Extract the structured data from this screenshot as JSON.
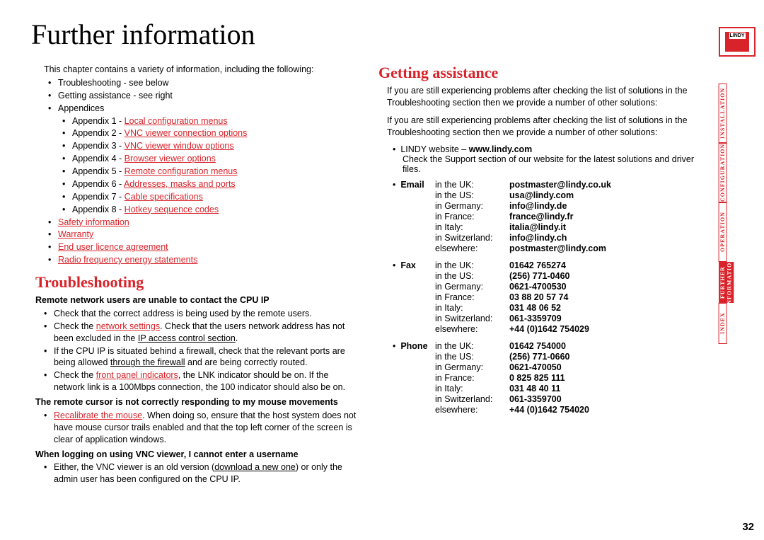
{
  "page_title": "Further information",
  "page_number": "32",
  "logo_text": "LINDY",
  "sidebar": {
    "tabs": [
      {
        "label": "INSTALLATION",
        "active": false
      },
      {
        "label": "CONFIGURATION",
        "active": false
      },
      {
        "label": "OPERATION",
        "active": false
      },
      {
        "label": "FURTHER\nINFORMATION",
        "active": true
      },
      {
        "label": "INDEX",
        "active": false
      }
    ]
  },
  "left": {
    "intro": "This chapter contains a variety of information, including the following:",
    "top_items": [
      {
        "text": "Troubleshooting - see below"
      },
      {
        "text": "Getting assistance - see right"
      },
      {
        "text": "Appendices"
      }
    ],
    "appendices": [
      {
        "prefix": "Appendix 1 - ",
        "link": "Local configuration menus"
      },
      {
        "prefix": "Appendix 2 - ",
        "link": "VNC viewer connection options"
      },
      {
        "prefix": "Appendix 3 - ",
        "link": "VNC viewer window options"
      },
      {
        "prefix": "Appendix 4 - ",
        "link": "Browser viewer options"
      },
      {
        "prefix": "Appendix 5 - ",
        "link": "Remote configuration menus"
      },
      {
        "prefix": "Appendix 6 - ",
        "link": "Addresses, masks and ports"
      },
      {
        "prefix": "Appendix 7 - ",
        "link": "Cable specifications"
      },
      {
        "prefix": "Appendix 8 - ",
        "link": "Hotkey sequence codes"
      }
    ],
    "extra_links": [
      "Safety information",
      "Warranty",
      "End user licence agreement",
      "Radio frequency energy statements"
    ],
    "troubleshooting_heading": "Troubleshooting",
    "ts1": {
      "head": "Remote network users are unable to contact the CPU IP",
      "b1": "Check that the correct address is being used by the remote users.",
      "b2_pre": "Check the ",
      "b2_link": "network settings",
      "b2_mid": ". Check that the users network address has not been excluded in the ",
      "b2_link2": "IP access control section",
      "b2_post": ".",
      "b3_pre": "If the CPU IP is situated behind a firewall, check that the relevant ports are being allowed ",
      "b3_link": "through the firewall",
      "b3_post": " and are being correctly routed.",
      "b4_pre": "Check the ",
      "b4_link": "front panel indicators",
      "b4_post": ", the LNK indicator should be on. If the network link is a 100Mbps connection, the 100 indicator should also be on."
    },
    "ts2": {
      "head": "The remote cursor is not correctly responding to my mouse movements",
      "b1_link": "Recalibrate the mouse",
      "b1_post": ". When doing so, ensure that the host system does not have mouse cursor trails enabled and that the top left corner of the screen is clear of application windows."
    },
    "ts3": {
      "head": "When logging on using VNC viewer, I cannot enter a username",
      "b1_pre": "Either, the VNC viewer is an old version (",
      "b1_link": "download a new one",
      "b1_post": ") or only the admin user has been configured on the CPU IP."
    }
  },
  "right": {
    "heading": "Getting assistance",
    "p1": "If you are still experiencing problems after checking the list of solutions in the Troubleshooting section then we provide a number of other solutions:",
    "p2": "If you are still experiencing problems after checking the list of solutions in the Troubleshooting section then we provide a number of other solutions:",
    "website_label_pre": "LINDY website – ",
    "website_label_bold": "www.lindy.com",
    "website_desc": "Check the Support section of our website for the latest solutions and driver files.",
    "contacts": [
      {
        "type": "Email",
        "rows": [
          {
            "loc": "in the UK:",
            "val": "postmaster@lindy.co.uk"
          },
          {
            "loc": "in the US:",
            "val": "usa@lindy.com"
          },
          {
            "loc": "in Germany:",
            "val": "info@lindy.de"
          },
          {
            "loc": "in France:",
            "val": "france@lindy.fr"
          },
          {
            "loc": "in Italy:",
            "val": "italia@lindy.it"
          },
          {
            "loc": "in Switzerland:",
            "val": "info@lindy.ch"
          },
          {
            "loc": "elsewhere:",
            "val": "postmaster@lindy.com"
          }
        ]
      },
      {
        "type": "Fax",
        "rows": [
          {
            "loc": "in the UK:",
            "val": "01642 765274"
          },
          {
            "loc": "in the US:",
            "val": "(256) 771-0460"
          },
          {
            "loc": "in Germany:",
            "val": "0621-4700530"
          },
          {
            "loc": "in France:",
            "val": "03 88 20 57 74"
          },
          {
            "loc": "in Italy:",
            "val": "031 48 06 52"
          },
          {
            "loc": "in Switzerland:",
            "val": "061-3359709"
          },
          {
            "loc": "elsewhere:",
            "val": "+44 (0)1642 754029"
          }
        ]
      },
      {
        "type": "Phone",
        "rows": [
          {
            "loc": "in the UK:",
            "val": "01642 754000"
          },
          {
            "loc": "in the US:",
            "val": "(256) 771-0660"
          },
          {
            "loc": "in Germany:",
            "val": "0621-470050"
          },
          {
            "loc": "in France:",
            "val": "0 825 825 111"
          },
          {
            "loc": "in Italy:",
            "val": "031 48 40 11"
          },
          {
            "loc": "in Switzerland:",
            "val": "061-3359700"
          },
          {
            "loc": "elsewhere:",
            "val": "+44 (0)1642 754020"
          }
        ]
      }
    ]
  }
}
